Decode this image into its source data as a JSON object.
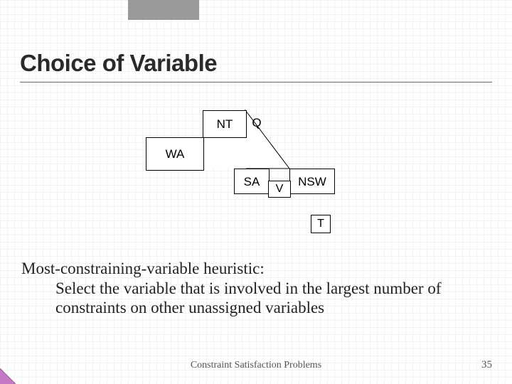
{
  "heading": "Choice of Variable",
  "map": {
    "WA": "WA",
    "NT": "NT",
    "Q": "Q",
    "SA": "SA",
    "NSW": "NSW",
    "V": "V",
    "T": "T"
  },
  "body": {
    "lead": "Most-constraining-variable heuristic:",
    "rest": "Select the variable that is involved in the largest number of constraints on other unassigned variables"
  },
  "footer": "Constraint Satisfaction Problems",
  "page": "35"
}
